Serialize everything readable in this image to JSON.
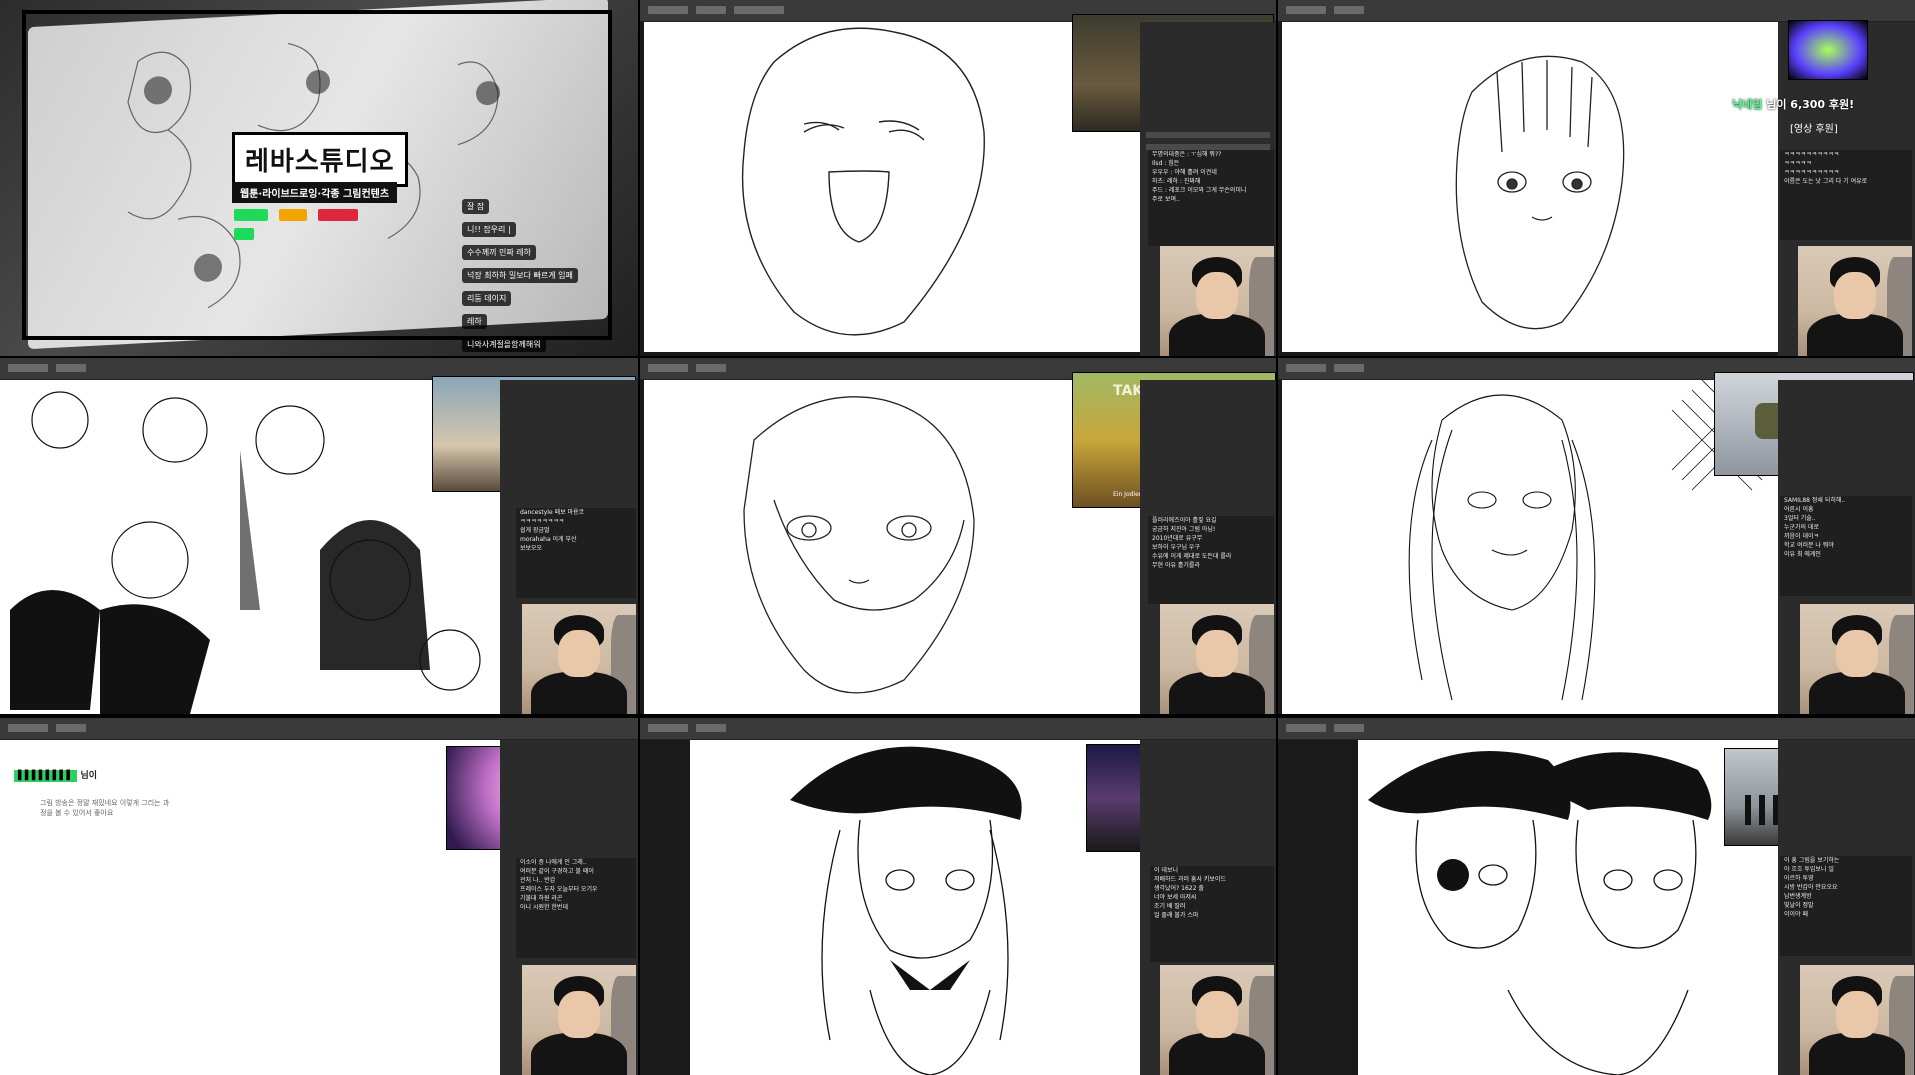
{
  "grid": {
    "cell0": {
      "title": "레바스튜디오",
      "subtitle": "웹툰·라이브드로잉·각종 그림컨텐츠",
      "overlay_chat": [
        {
          "nick": "",
          "text": "잘 잡"
        },
        {
          "nick": "",
          "text": "니!! 잡우리 |"
        },
        {
          "nick": "",
          "text": "수수께끼 민짜 레하"
        },
        {
          "nick": "",
          "text": "넉장 최하하 밀보다 빠르게 임페"
        },
        {
          "nick": "",
          "text": "리둠 데이지"
        },
        {
          "nick": "",
          "text": "레하"
        },
        {
          "nick": "",
          "text": "니와사계절을함께해워"
        }
      ]
    },
    "cell1": {
      "chat": [
        "무명의대중은 : ㅜ심해 뭐??",
        "Ilsd : 힘든",
        "우우우 : 야해 흘려 이견네",
        "하츠: 레하 : 진짜해",
        "주드 : 레포크 이모와 그게 무슨의미니",
        "주로 보며.."
      ]
    },
    "cell2": {
      "donation_name": "닉네임",
      "donation_text": "님이 6,300 후원!",
      "donation_amount": "6,300",
      "donation_sub": "[영상 후원]",
      "chat": [
        "ㅋㅋㅋㅋㅋㅋㅋㅋㅋㅋ",
        "ㅋㅋㅋㅋㅋ",
        "ㅋㅋㅋㅋㅋㅋㅋㅋㅋㅋ",
        "이름은 도는 낫 그리 다 기 여유로"
      ]
    },
    "cell3": {
      "chat": [
        "dancestyle 패보 마용코",
        "ㅋㅋㅋㅋㅋㅋㅋㅋ",
        "쉽게 장금멀",
        "morahaha 이게 부산",
        "보보오오"
      ]
    },
    "cell4": {
      "pip_title": "TAKEO ISCHI",
      "pip_sub": "Ein Jodler geht hinaus in die Welt",
      "chat": [
        "플러리에즈이아 흘짚 요길",
        "궁금하 지진아 그럼 아님!",
        "2010년대로 유구무",
        "보하이 우구님 우구",
        "수유에 이게 제대로 도든대 를라",
        "무현 아유 흘기를라"
      ]
    },
    "cell5": {
      "chat": [
        "SAMIL88 정쇄 되히해..",
        "어른시 이흥",
        "3얼터 기술..",
        "누군가의 데로",
        "끼음이 데이ㅋ",
        "학교 여러분 나 뭐야",
        "이유 최 에게인"
      ]
    },
    "cell6": {
      "donation_line": "님이",
      "message": "그림 방송은 정말 재밌네요 이렇게 그리는 과정을 볼 수 있어서 좋아요",
      "chat": [
        "이소이 중 나에게 인 그래..",
        "여러분 같이 구경하고 볼 때이",
        "관처 나.. 반갑",
        "프레이스 두자 오늘부터 오기우",
        "기불대 하원 라곤",
        "아니 시원한 한번데"
      ]
    },
    "cell7": {
      "chat": [
        "이 데보니",
        "저배하드 과러 흥사 키보이드",
        "생각났어? 1622 출",
        "너야 보세 아저씨",
        "조기 배 딸러",
        "얼 줄래 불가 스마"
      ]
    },
    "cell8": {
      "chat": [
        "이 흥 그림을 보기하는",
        "아 흐흐 투입보니 일",
        "아르하 투영",
        "시방 반갑아 만요오요",
        "남번생계방",
        "빛날이 정말",
        "이이야 패"
      ]
    }
  },
  "colors": {
    "background": "#000000",
    "toolbar": "#3a3a3a",
    "panel": "#2b2b2b",
    "canvas": "#ffffff",
    "accent_gold": "#ffcc33"
  }
}
